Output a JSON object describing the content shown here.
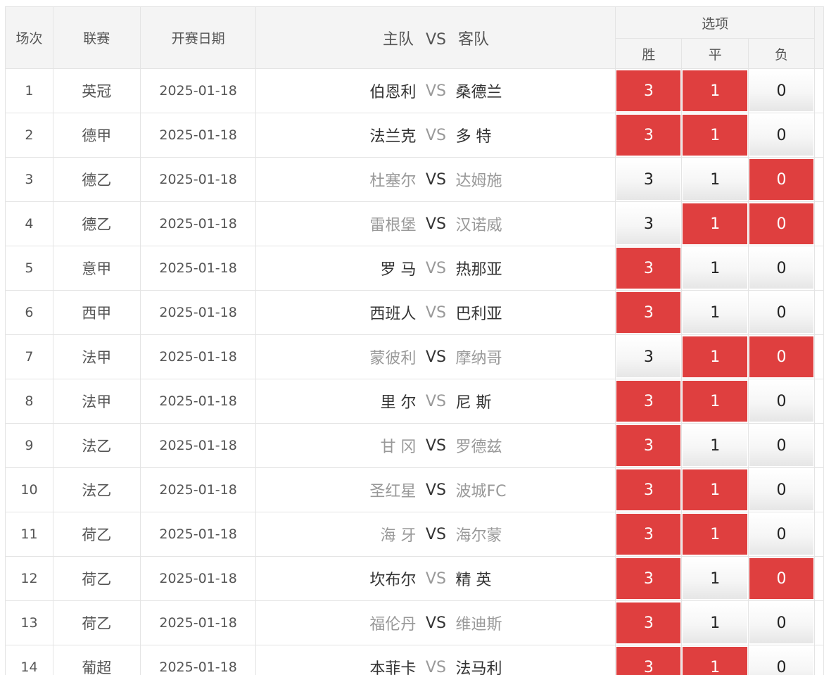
{
  "headers": {
    "index": "场次",
    "league": "联赛",
    "date": "开赛日期",
    "teams_home": "主队",
    "teams_vs": "VS",
    "teams_away": "客队",
    "options": "选项",
    "win": "胜",
    "draw": "平",
    "lose": "负"
  },
  "vs_text": "VS",
  "colors": {
    "selected": "#df3f3f",
    "header_bg": "#f4f4f4"
  },
  "rows": [
    {
      "idx": "1",
      "league": "英冠",
      "date": "2025-01-18",
      "home": "伯恩利",
      "away": "桑德兰",
      "muted": false,
      "vs_dark": false,
      "opts": [
        "3",
        "1",
        "0"
      ],
      "sel": [
        true,
        true,
        false
      ]
    },
    {
      "idx": "2",
      "league": "德甲",
      "date": "2025-01-18",
      "home": "法兰克",
      "away": "多 特",
      "muted": false,
      "vs_dark": false,
      "opts": [
        "3",
        "1",
        "0"
      ],
      "sel": [
        true,
        true,
        false
      ]
    },
    {
      "idx": "3",
      "league": "德乙",
      "date": "2025-01-18",
      "home": "杜塞尔",
      "away": "达姆施",
      "muted": true,
      "vs_dark": true,
      "opts": [
        "3",
        "1",
        "0"
      ],
      "sel": [
        false,
        false,
        true
      ]
    },
    {
      "idx": "4",
      "league": "德乙",
      "date": "2025-01-18",
      "home": "雷根堡",
      "away": "汉诺威",
      "muted": true,
      "vs_dark": true,
      "opts": [
        "3",
        "1",
        "0"
      ],
      "sel": [
        false,
        true,
        true
      ]
    },
    {
      "idx": "5",
      "league": "意甲",
      "date": "2025-01-18",
      "home": "罗 马",
      "away": "热那亚",
      "muted": false,
      "vs_dark": false,
      "opts": [
        "3",
        "1",
        "0"
      ],
      "sel": [
        true,
        false,
        false
      ]
    },
    {
      "idx": "6",
      "league": "西甲",
      "date": "2025-01-18",
      "home": "西班人",
      "away": "巴利亚",
      "muted": false,
      "vs_dark": false,
      "opts": [
        "3",
        "1",
        "0"
      ],
      "sel": [
        true,
        false,
        false
      ]
    },
    {
      "idx": "7",
      "league": "法甲",
      "date": "2025-01-18",
      "home": "蒙彼利",
      "away": "摩纳哥",
      "muted": true,
      "vs_dark": true,
      "opts": [
        "3",
        "1",
        "0"
      ],
      "sel": [
        false,
        true,
        true
      ]
    },
    {
      "idx": "8",
      "league": "法甲",
      "date": "2025-01-18",
      "home": "里 尔",
      "away": "尼 斯",
      "muted": false,
      "vs_dark": false,
      "opts": [
        "3",
        "1",
        "0"
      ],
      "sel": [
        true,
        true,
        false
      ]
    },
    {
      "idx": "9",
      "league": "法乙",
      "date": "2025-01-18",
      "home": "甘 冈",
      "away": "罗德兹",
      "muted": true,
      "vs_dark": true,
      "opts": [
        "3",
        "1",
        "0"
      ],
      "sel": [
        true,
        false,
        false
      ]
    },
    {
      "idx": "10",
      "league": "法乙",
      "date": "2025-01-18",
      "home": "圣红星",
      "away": "波城FC",
      "muted": true,
      "vs_dark": true,
      "opts": [
        "3",
        "1",
        "0"
      ],
      "sel": [
        true,
        true,
        false
      ]
    },
    {
      "idx": "11",
      "league": "荷乙",
      "date": "2025-01-18",
      "home": "海 牙",
      "away": "海尔蒙",
      "muted": true,
      "vs_dark": true,
      "opts": [
        "3",
        "1",
        "0"
      ],
      "sel": [
        true,
        true,
        false
      ]
    },
    {
      "idx": "12",
      "league": "荷乙",
      "date": "2025-01-18",
      "home": "坎布尔",
      "away": "精 英",
      "muted": false,
      "vs_dark": false,
      "opts": [
        "3",
        "1",
        "0"
      ],
      "sel": [
        true,
        false,
        true
      ]
    },
    {
      "idx": "13",
      "league": "荷乙",
      "date": "2025-01-18",
      "home": "福伦丹",
      "away": "维迪斯",
      "muted": true,
      "vs_dark": true,
      "opts": [
        "3",
        "1",
        "0"
      ],
      "sel": [
        true,
        false,
        false
      ]
    },
    {
      "idx": "14",
      "league": "葡超",
      "date": "2025-01-18",
      "home": "本菲卡",
      "away": "法马利",
      "muted": false,
      "vs_dark": false,
      "opts": [
        "3",
        "1",
        "0"
      ],
      "sel": [
        true,
        true,
        false
      ]
    }
  ]
}
